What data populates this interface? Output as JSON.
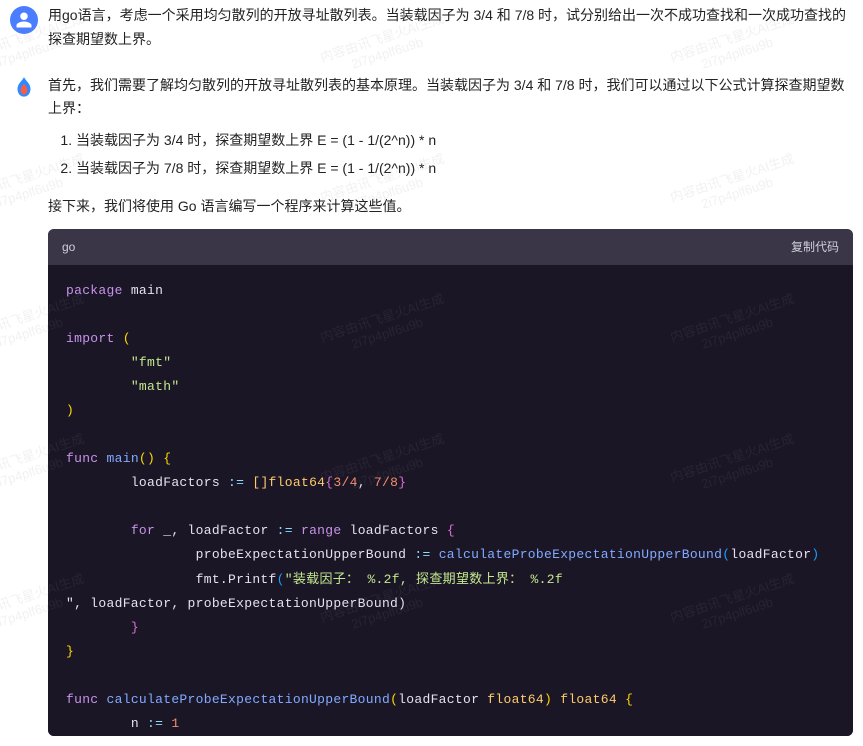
{
  "watermark": {
    "line1": "内容由讯飞星火AI生成",
    "line2": "2i7p4plf6u9b"
  },
  "user": {
    "message": "用go语言，考虑一个采用均匀散列的开放寻址散列表。当装载因子为 3/4 和 7/8 时，试分别给出一次不成功查找和一次成功查找的探查期望数上界。"
  },
  "assistant": {
    "intro": "首先，我们需要了解均匀散列的开放寻址散列表的基本原理。当装载因子为 3/4 和 7/8 时，我们可以通过以下公式计算探查期望数上界：",
    "list": [
      "当装载因子为 3/4 时，探查期望数上界 E = (1 - 1/(2^n)) * n",
      "当装载因子为 7/8 时，探查期望数上界 E = (1 - 1/(2^n)) * n"
    ],
    "next": "接下来，我们将使用 Go 语言编写一个程序来计算这些值。",
    "code": {
      "lang": "go",
      "copy_label": "复制代码",
      "tokens": {
        "package": "package",
        "main": "main",
        "import": "import",
        "fmt": "\"fmt\"",
        "math": "\"math\"",
        "func": "func",
        "main_fn": "main",
        "loadFactors": "loadFactors",
        "assign": ":=",
        "slice_type": "[]float64",
        "v34": "3/4",
        "v78": "7/8",
        "for": "for",
        "underscore": "_",
        "loadFactor": "loadFactor",
        "range": "range",
        "probeVar": "probeExpectationUpperBound",
        "calcFn": "calculateProbeExpectationUpperBound",
        "fmtPrintf": "fmt.Printf",
        "printf_str": "\"装载因子： %.2f, 探查期望数上界： %.2f",
        "trailing_fmt": "\", loadFactor, probeExpectationUpperBound)",
        "float64": "float64",
        "n": "n",
        "one": "1"
      }
    }
  }
}
